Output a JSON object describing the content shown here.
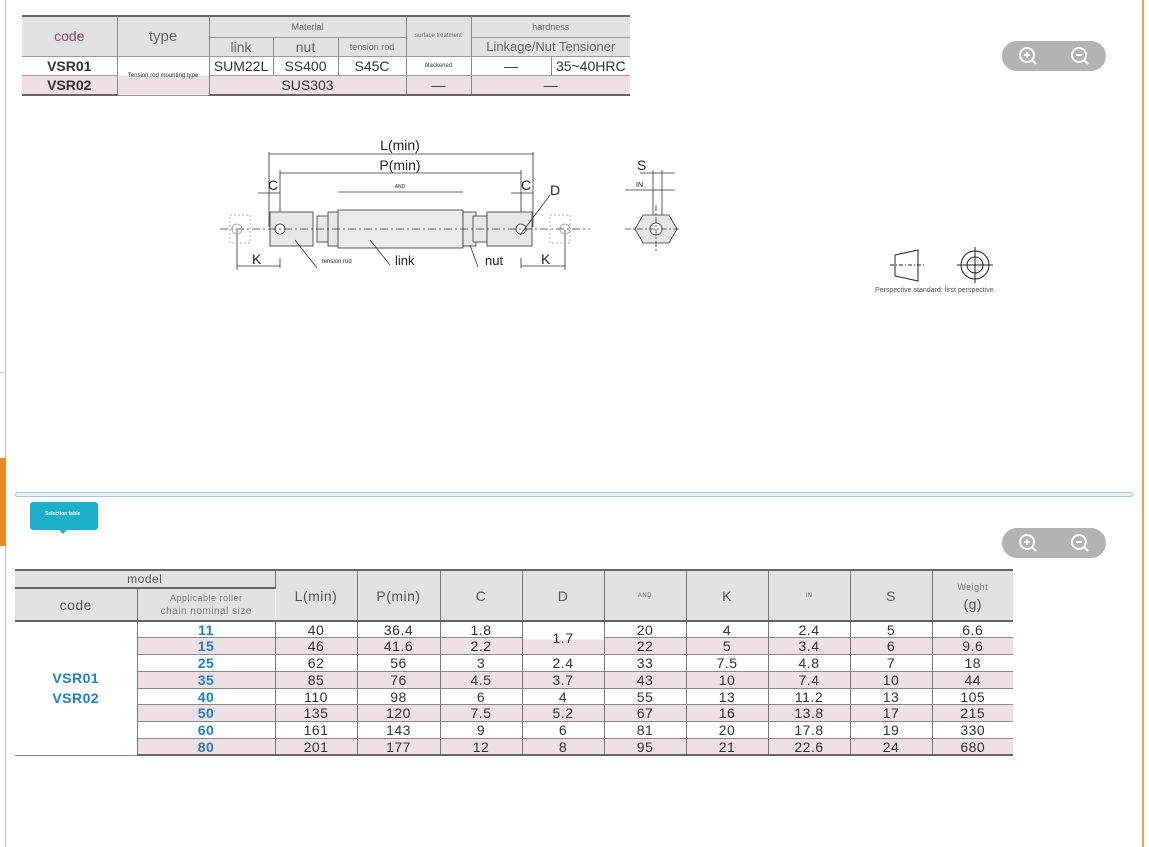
{
  "material_table": {
    "headers": {
      "code": "code",
      "type": "type",
      "material": "Material",
      "link": "link",
      "nut": "nut",
      "tension_rod": "tension rod",
      "surface": "surface treatment",
      "hardness": "hardness",
      "hardness_sub": "Linkage/Nut Tensioner"
    },
    "rows": [
      {
        "code": "VSR01",
        "type": "Tension rod mounting type",
        "link": "SUM22L",
        "nut": "SS400",
        "tension_rod": "S45C",
        "surface": "blackened",
        "hardness_link": "—",
        "hardness_tension": "35~40HRC"
      },
      {
        "code": "VSR02",
        "material": "SUS303",
        "surface": "—",
        "hardness": "—"
      }
    ]
  },
  "zoom": {
    "in_icon": "zoom-in-icon",
    "out_icon": "zoom-out-icon"
  },
  "drawing": {
    "L": "L(min)",
    "P": "P(min)",
    "C": "C",
    "D": "D",
    "AND": "AND",
    "K": "K",
    "S": "S",
    "IN": "IN",
    "tension_rod": "tension rod",
    "link": "link",
    "nut": "nut"
  },
  "perspective": "Perspective standard: first perspective",
  "selection_tab": "Selection table",
  "selection_table": {
    "headers": {
      "model": "model",
      "code": "code",
      "roller1": "Applicable roller",
      "roller2": "chain nominal size",
      "L": "L(min)",
      "P": "P(min)",
      "C": "C",
      "D": "D",
      "AND": "AND",
      "K": "K",
      "IN": "IN",
      "S": "S",
      "weight1": "Weight",
      "weight2": "(g)"
    },
    "codes": [
      "VSR01",
      "VSR02"
    ],
    "rows": [
      {
        "size": "11",
        "L": "40",
        "P": "36.4",
        "C": "1.8",
        "D": "1.7",
        "AND": "20",
        "K": "4",
        "IN": "2.4",
        "S": "5",
        "W": "6.6"
      },
      {
        "size": "15",
        "L": "46",
        "P": "41.6",
        "C": "2.2",
        "AND": "22",
        "K": "5",
        "IN": "3.4",
        "S": "6",
        "W": "9.6"
      },
      {
        "size": "25",
        "L": "62",
        "P": "56",
        "C": "3",
        "D": "2.4",
        "AND": "33",
        "K": "7.5",
        "IN": "4.8",
        "S": "7",
        "W": "18"
      },
      {
        "size": "35",
        "L": "85",
        "P": "76",
        "C": "4.5",
        "D": "3.7",
        "AND": "43",
        "K": "10",
        "IN": "7.4",
        "S": "10",
        "W": "44"
      },
      {
        "size": "40",
        "L": "110",
        "P": "98",
        "C": "6",
        "D": "4",
        "AND": "55",
        "K": "13",
        "IN": "11.2",
        "S": "13",
        "W": "105"
      },
      {
        "size": "50",
        "L": "135",
        "P": "120",
        "C": "7.5",
        "D": "5.2",
        "AND": "67",
        "K": "16",
        "IN": "13.8",
        "S": "17",
        "W": "215"
      },
      {
        "size": "60",
        "L": "161",
        "P": "143",
        "C": "9",
        "D": "6",
        "AND": "81",
        "K": "20",
        "IN": "17.8",
        "S": "19",
        "W": "330"
      },
      {
        "size": "80",
        "L": "201",
        "P": "177",
        "C": "12",
        "D": "8",
        "AND": "95",
        "K": "21",
        "IN": "22.6",
        "S": "24",
        "W": "680"
      }
    ]
  },
  "colors": {
    "accent": "#f08a24",
    "tab": "#1eb0c8",
    "code_blue": "#1f7fbf",
    "row_pink": "#efe0e6"
  }
}
